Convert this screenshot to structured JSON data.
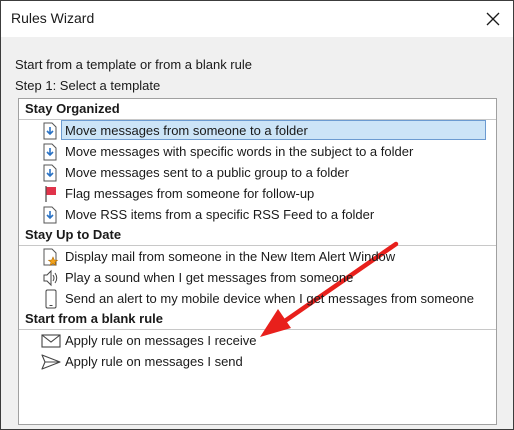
{
  "window": {
    "title": "Rules Wizard"
  },
  "intro_text": "Start from a template or from a blank rule",
  "step_text": "Step 1: Select a template",
  "groups": [
    {
      "header": "Stay Organized",
      "items": [
        {
          "label": "Move messages from someone to a folder",
          "icon": "folder-move-icon",
          "selected": true
        },
        {
          "label": "Move messages with specific words in the subject to a folder",
          "icon": "folder-move-icon"
        },
        {
          "label": "Move messages sent to a public group to a folder",
          "icon": "folder-move-icon"
        },
        {
          "label": "Flag messages from someone for follow-up",
          "icon": "flag-icon"
        },
        {
          "label": "Move RSS items from a specific RSS Feed to a folder",
          "icon": "folder-move-icon"
        }
      ]
    },
    {
      "header": "Stay Up to Date",
      "items": [
        {
          "label": "Display mail from someone in the New Item Alert Window",
          "icon": "alert-window-icon"
        },
        {
          "label": "Play a sound when I get messages from someone",
          "icon": "speaker-icon"
        },
        {
          "label": "Send an alert to my mobile device when I get messages from someone",
          "icon": "mobile-icon"
        }
      ]
    },
    {
      "header": "Start from a blank rule",
      "items": [
        {
          "label": "Apply rule on messages I receive",
          "icon": "envelope-icon"
        },
        {
          "label": "Apply rule on messages I send",
          "icon": "send-icon"
        }
      ]
    }
  ],
  "colors": {
    "selection_bg": "#cce4f7",
    "selection_border": "#6c9bd1",
    "annotation_arrow": "#e8201c",
    "flag": "#e0334a",
    "icon_blue": "#2a72c4"
  }
}
